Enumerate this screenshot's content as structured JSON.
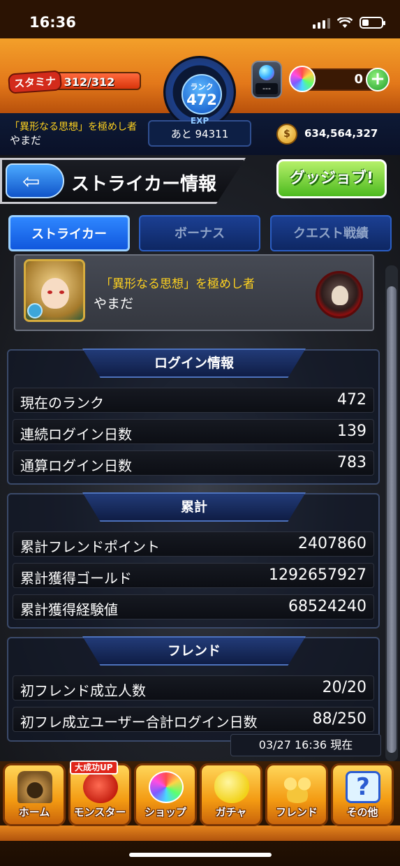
{
  "status_bar": {
    "time": "16:36"
  },
  "header": {
    "stamina_label": "スタミナ",
    "stamina_text": "312/312",
    "stamina_fraction": 1.0,
    "rank_label": "ランク",
    "rank_value": "472",
    "exp_label": "EXP",
    "exp_remaining": "あと 94311",
    "item_count": "---",
    "orb_count": "0",
    "plus": "+",
    "title": "「異形なる思想」を極めし者",
    "username": "やまだ",
    "gold": "634,564,327"
  },
  "page": {
    "back_arrow": "⇦",
    "title": "ストライカー情報",
    "gg_button": "グッジョブ!"
  },
  "tabs": [
    {
      "label": "ストライカー",
      "active": true
    },
    {
      "label": "ボーナス",
      "active": false
    },
    {
      "label": "クエスト戦績",
      "active": false
    }
  ],
  "profile": {
    "title": "「異形なる思想」を極めし者",
    "name": "やまだ"
  },
  "sections": {
    "login": {
      "heading": "ログイン情報",
      "rows": [
        {
          "label": "現在のランク",
          "value": "472"
        },
        {
          "label": "連続ログイン日数",
          "value": "139"
        },
        {
          "label": "通算ログイン日数",
          "value": "783"
        }
      ]
    },
    "totals": {
      "heading": "累計",
      "rows": [
        {
          "label": "累計フレンドポイント",
          "value": "2407860"
        },
        {
          "label": "累計獲得ゴールド",
          "value": "1292657927"
        },
        {
          "label": "累計獲得経験値",
          "value": "68524240"
        }
      ]
    },
    "friend": {
      "heading": "フレンド",
      "rows": [
        {
          "label": "初フレンド成立人数",
          "value": "20/20"
        },
        {
          "label": "初フレ成立ユーザー合計ログイン日数",
          "value": "88/250"
        }
      ]
    }
  },
  "timestamp": "03/27 16:36 現在",
  "bottom_nav": {
    "badge": "大成功UP",
    "items": [
      {
        "label": "ホーム",
        "icon": "castle-icon"
      },
      {
        "label": "モンスター",
        "icon": "monster-icon"
      },
      {
        "label": "ショップ",
        "icon": "orb-icon"
      },
      {
        "label": "ガチャ",
        "icon": "egg-icon"
      },
      {
        "label": "フレンド",
        "icon": "friends-icon"
      },
      {
        "label": "その他",
        "icon": "question-icon"
      }
    ]
  },
  "colors": {
    "header_orange": "#e3781a",
    "title_yellow": "#ffd21f",
    "tab_active": "#1057dd",
    "gg_green": "#4cba1f"
  }
}
